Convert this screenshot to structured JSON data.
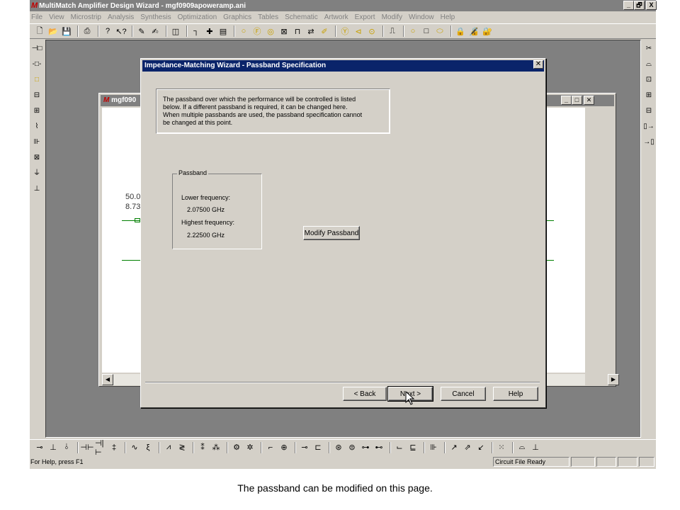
{
  "app": {
    "title": "MultiMatch Amplifier Design Wizard - mgf0909apoweramp.ani",
    "logo": "M",
    "window_controls": [
      "_",
      "🗗",
      "X"
    ]
  },
  "menu": [
    "File",
    "View",
    "Microstrip",
    "Analysis",
    "Synthesis",
    "Optimization",
    "Graphics",
    "Tables",
    "Schematic",
    "Artwork",
    "Export",
    "Modify",
    "Window",
    "Help"
  ],
  "toolbar": {
    "icons": [
      "new-icon",
      "open-icon",
      "save-icon",
      "print-icon",
      "help-icon",
      "context-help-icon",
      "draw-icon",
      "draw-alt-icon",
      "component-icon",
      "tee-icon",
      "cross-icon",
      "element-icon",
      "circle-icon",
      "f-icon",
      "target-icon",
      "grid-icon",
      "port-icon",
      "equals-icon",
      "pencil-icon",
      "y-icon",
      "left-circle-icon",
      "dot-icon",
      "pulse-icon",
      "ring-icon",
      "square-icon",
      "oval-icon",
      "lock-a-icon",
      "lock-b-icon",
      "lock-c-icon"
    ]
  },
  "child_window": {
    "title": "mgf090",
    "logo": "M",
    "values": [
      "50.0",
      "8.73"
    ]
  },
  "dialog": {
    "title": "Impedance-Matching Wizard - Passband Specification",
    "info_lines": [
      "The passband over which the performance will be controlled is listed",
      "below. If a different passband is required, it can be changed here.",
      "When multiple passbands are used, the passband specification cannot",
      "be changed at this point."
    ],
    "group_title": "Passband",
    "lower_label": "Lower frequency:",
    "lower_value": "2.07500 GHz",
    "highest_label": "Highest frequency:",
    "highest_value": "2.22500 GHz",
    "modify_button": "Modify Passband",
    "back_button": "< Back",
    "next_button": "Next >",
    "cancel_button": "Cancel",
    "help_button": "Help"
  },
  "status": {
    "help_text": "For Help, press F1",
    "state": "Circuit File Ready"
  },
  "caption": "The passband can be modified on this page."
}
